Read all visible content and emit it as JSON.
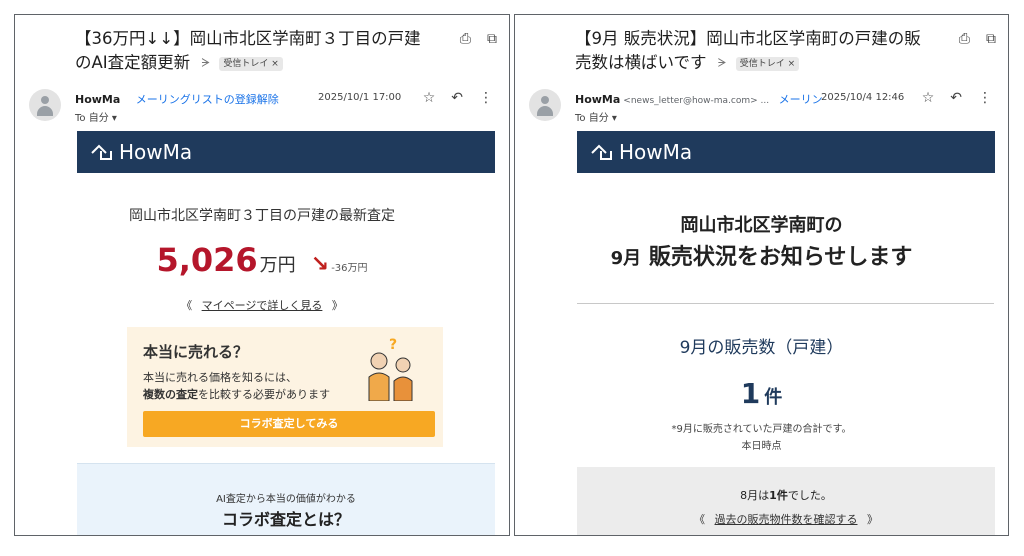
{
  "left": {
    "subject": "【36万円↓↓】岡山市北区学南町３丁目の戸建のAI査定額更新",
    "importance_marker": "ᗒ",
    "label_chip": "受信トレイ ×",
    "sender": "HowMa",
    "unsubscribe": "メーリングリストの登録解除",
    "date": "2025/10/1 17:00",
    "to": "To 自分 ▾",
    "banner_logo": "HowMa",
    "title": "岡山市北区学南町３丁目の戸建の最新査定",
    "price_value": "5,026",
    "price_unit": "万円",
    "price_diff": "-36万円",
    "mypage_link": "マイページで詳しく見る",
    "link_open": "《",
    "link_close": "》",
    "collab_question": "本当に売れる？",
    "collab_text_1": "本当に売れる価格を知るには、",
    "collab_text_bold": "複数の査定",
    "collab_text_2": "を比較する必要があります",
    "collab_button": "コラボ査定してみる",
    "what_sub": "AI査定から本当の価値がわかる",
    "what_title": "コラボ査定とは？"
  },
  "right": {
    "subject": "【9月 販売状況】岡山市北区学南町の戸建の販売数は横ばいです",
    "importance_marker": "ᗒ",
    "label_chip": "受信トレイ ×",
    "sender": "HowMa",
    "sender_email": "<news_letter@how-ma.com> ...",
    "unsubscribe": "メーリン",
    "date": "2025/10/4 12:46",
    "to": "To 自分 ▾",
    "banner_logo": "HowMa",
    "heading_1": "岡山市北区学南町の",
    "heading_2_month": "9月",
    "heading_2_rest": "販売状況をお知らせします",
    "sales_title": "9月の販売数（戸建）",
    "count_value": "1",
    "count_unit": "件",
    "note": "*9月に販売されていた戸建の合計です。",
    "as_of": "本日時点",
    "prev_month_pre": "8月は",
    "prev_month_bold": "1件",
    "prev_month_post": "でした。",
    "past_link": "過去の販売物件数を確認する",
    "link_open": "《",
    "link_close": "》"
  },
  "icons": {
    "print": "⎙",
    "open_new": "⧉",
    "star": "☆",
    "reply": "↶",
    "more": "⋮",
    "down_arrow": "↘"
  },
  "colors": {
    "banner": "#1f3a5c",
    "price_red": "#b5162b",
    "collab_bg": "#fdf3e2",
    "collab_button": "#f7a823",
    "what_bg": "#eaf3fb",
    "link_blue": "#1a73e8"
  }
}
